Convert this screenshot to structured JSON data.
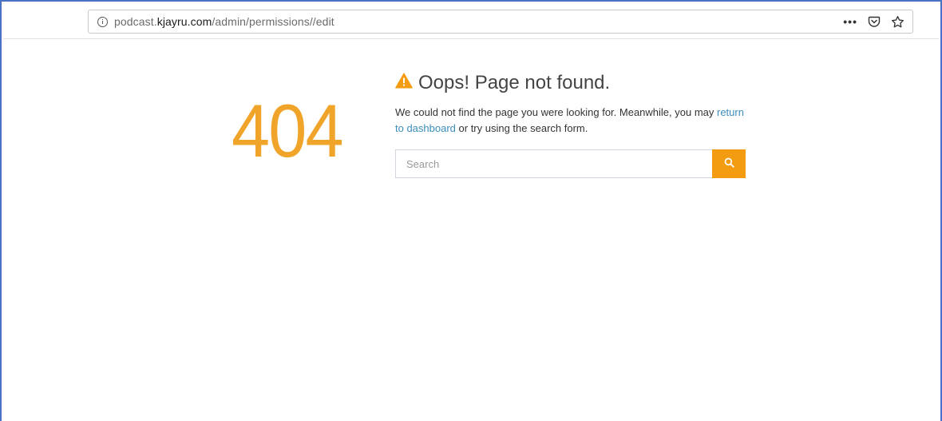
{
  "browser": {
    "url_prefix": "podcast.",
    "url_host": "kjayru.com",
    "url_path": "/admin/permissions//edit",
    "menu_dots": "•••"
  },
  "error": {
    "code": "404",
    "title": "Oops! Page not found.",
    "message_before": "We could not find the page you were looking for. Meanwhile, you may ",
    "link_text": "return to dashboard",
    "message_after": " or try using the search form."
  },
  "search": {
    "placeholder": "Search"
  },
  "colors": {
    "accent": "#f39c12",
    "code": "#f0a52a",
    "link": "#3c8dbc"
  },
  "icons": {
    "info": "info-icon",
    "pocket": "pocket-icon",
    "bookmark": "star-icon",
    "warning": "warning-icon",
    "search": "search-icon"
  }
}
